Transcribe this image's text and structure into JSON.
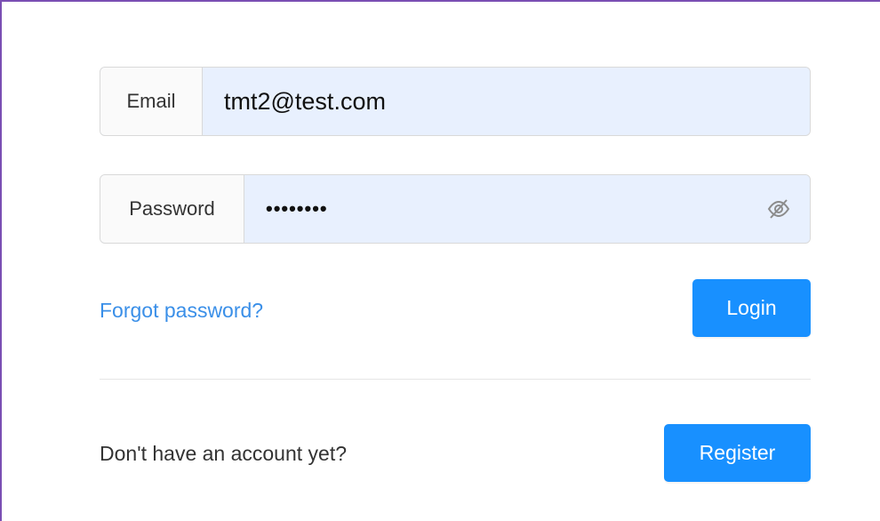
{
  "email": {
    "label": "Email",
    "value": "tmt2@test.com"
  },
  "password": {
    "label": "Password",
    "value": "••••••••",
    "toggle_icon": "eye-invisible-icon"
  },
  "forgot_password_link": "Forgot password?",
  "login_button": "Login",
  "register_prompt": "Don't have an account yet?",
  "register_button": "Register",
  "colors": {
    "accent": "#1890ff",
    "link": "#3a8fe8",
    "autofill_bg": "#e8f0fe",
    "frame_border": "#7a4fb3"
  }
}
